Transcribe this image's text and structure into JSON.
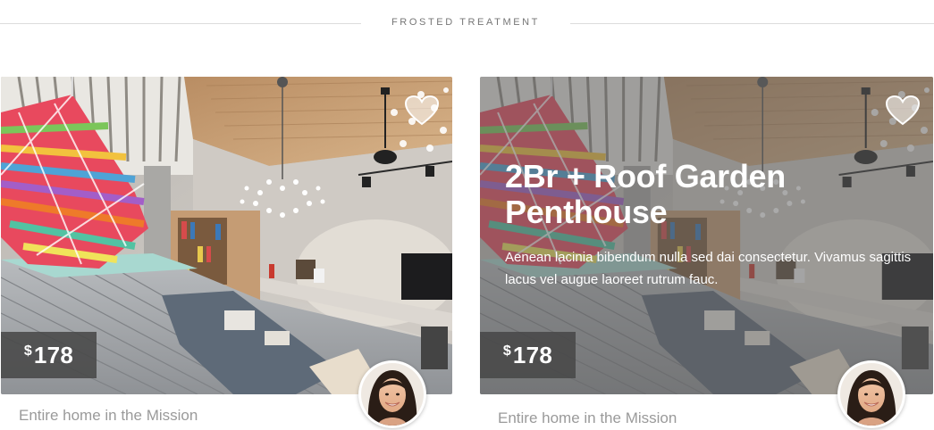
{
  "section": {
    "title": "FROSTED TREATMENT"
  },
  "cards": [
    {
      "variant": "plain",
      "price_currency": "$",
      "price_amount": "178",
      "caption": "Entire home in the Mission",
      "heart_icon": "heart-icon",
      "avatar": "host-avatar"
    },
    {
      "variant": "frosted",
      "title": "2Br + Roof Garden Penthouse",
      "description": "Aenean lacinia bibendum nulla sed dai consectetur. Vivamus sagittis lacus vel augue laoreet rutrum fauc.",
      "price_currency": "$",
      "price_amount": "178",
      "caption": "Entire home in the Mission",
      "heart_icon": "heart-icon",
      "avatar": "host-avatar"
    }
  ],
  "colors": {
    "frost_overlay": "#5c5c5c",
    "price_bg": "#484848",
    "caption_text": "#9a9a9a"
  }
}
